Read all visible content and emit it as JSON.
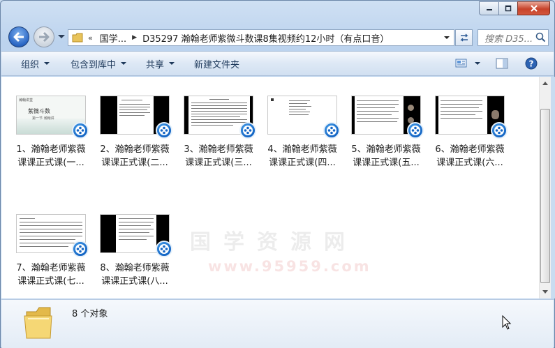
{
  "window": {
    "caption": {
      "minimize": "minimize",
      "maximize": "maximize",
      "close": "close"
    }
  },
  "address_bar": {
    "overflow_chevron": "«",
    "segments": [
      "国学...",
      "D35297 瀚翰老师紫微斗数课8集视频约12小时（有点口音）"
    ],
    "search_placeholder": "搜索 D35..."
  },
  "command_bar": {
    "organize": "组织",
    "include_in_library": "包含到库中",
    "share": "共享",
    "new_folder": "新建文件夹"
  },
  "files": [
    {
      "line1": "1、瀚翰老师紫薇",
      "line2": "课课正式课(一..."
    },
    {
      "line1": "2、瀚翰老师紫薇",
      "line2": "课课正式课(二..."
    },
    {
      "line1": "3、瀚翰老师紫薇",
      "line2": "课课正式课(三..."
    },
    {
      "line1": "4、瀚翰老师紫薇",
      "line2": "课课正式课(四..."
    },
    {
      "line1": "5、瀚翰老师紫薇",
      "line2": "课课正式课(五..."
    },
    {
      "line1": "6、瀚翰老师紫薇",
      "line2": "课课正式课(六..."
    },
    {
      "line1": "7、瀚翰老师紫薇",
      "line2": "课课正式课(七..."
    },
    {
      "line1": "8、瀚翰老师紫薇",
      "line2": "课课正式课(八..."
    }
  ],
  "thumb_text": {
    "title": "紫微斗数",
    "subtitle": "第一节  瀚翰讲",
    "corner": "瀚翰讲堂"
  },
  "watermark": {
    "text": "国学资源网",
    "url": "www.95959.com"
  },
  "details": {
    "count_text": "8 个对象"
  },
  "colors": {
    "accent": "#1e395b",
    "badge": "#1465c4",
    "close": "#c7432b"
  }
}
